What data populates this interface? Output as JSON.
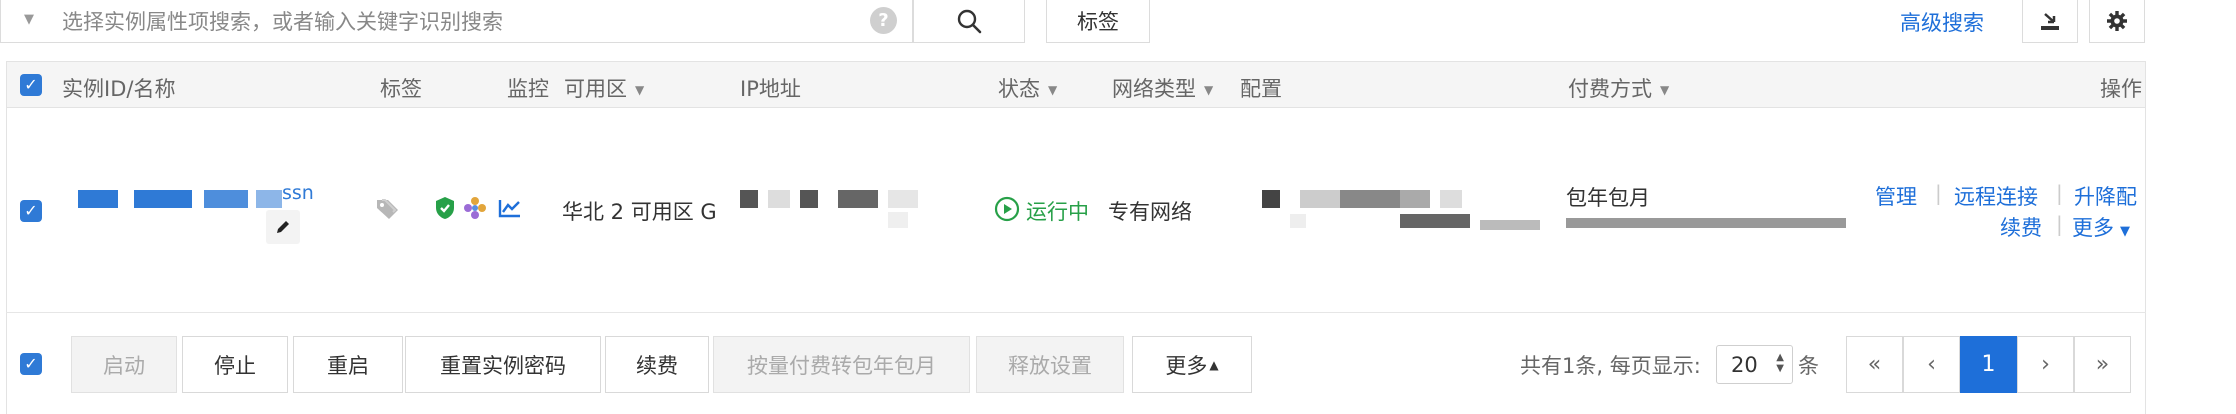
{
  "search": {
    "placeholder": "选择实例属性项搜索，或者输入关键字识别搜索",
    "help_label": "?",
    "tag_button": "标签",
    "advanced_search": "高级搜索"
  },
  "table": {
    "columns": {
      "id_name": "实例ID/名称",
      "tags": "标签",
      "monitor": "监控",
      "zone": "可用区",
      "ip": "IP地址",
      "status": "状态",
      "network_type": "网络类型",
      "config": "配置",
      "billing": "付费方式",
      "ops": "操作"
    },
    "row": {
      "name_suffix": "ssn",
      "zone": "华北 2 可用区 G",
      "status": "运行中",
      "network_type": "专有网络",
      "billing_method": "包年包月",
      "ops": {
        "manage": "管理",
        "remote_connect": "远程连接",
        "change_config": "升降配",
        "renew": "续费",
        "more": "更多"
      }
    }
  },
  "actions": {
    "start": "启动",
    "stop": "停止",
    "restart": "重启",
    "reset_password": "重置实例密码",
    "renew": "续费",
    "convert_billing": "按量付费转包年包月",
    "release_settings": "释放设置",
    "more": "更多"
  },
  "pagination": {
    "summary": "共有1条, 每页显示:",
    "page_size": "20",
    "unit": "条",
    "first": "«",
    "prev": "‹",
    "current": "1",
    "next": "›",
    "last": "»"
  },
  "colors": {
    "accent": "#1e6fd9",
    "running": "#27a048"
  }
}
